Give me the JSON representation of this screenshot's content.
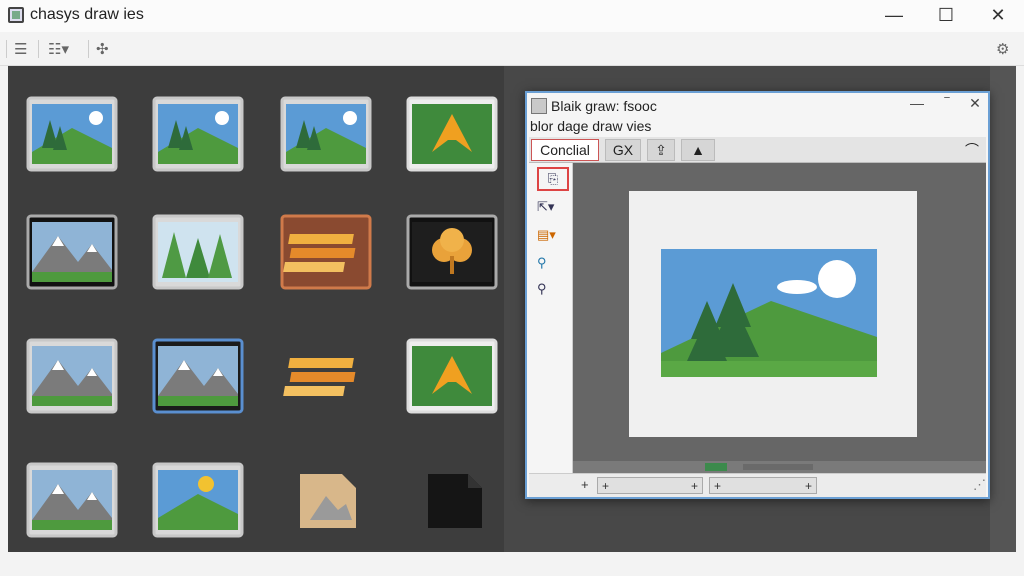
{
  "window": {
    "title": "chasys draw ies",
    "minimize": "—",
    "maximize": "☐",
    "close": "✕"
  },
  "toolbar": {
    "icons": [
      "align-left-icon",
      "list-dropdown-icon",
      "puzzle-icon",
      "gear-icon"
    ],
    "glyph_lines": "☰",
    "glyph_list": "☷▾",
    "glyph_puzzle": "✣",
    "glyph_gear": "⚙"
  },
  "gallery": {
    "rows": 4,
    "cols": 4,
    "items": [
      {
        "type": "landscape",
        "style": "framed"
      },
      {
        "type": "landscape",
        "style": "framed"
      },
      {
        "type": "landscape",
        "style": "folded"
      },
      {
        "type": "vector",
        "style": "green-doc"
      },
      {
        "type": "mountain",
        "style": "dark"
      },
      {
        "type": "forest",
        "style": "framed"
      },
      {
        "type": "stripes",
        "style": "orange"
      },
      {
        "type": "leaf",
        "style": "dark"
      },
      {
        "type": "mountain",
        "style": "framed"
      },
      {
        "type": "mountain",
        "style": "blue-border"
      },
      {
        "type": "stripes",
        "style": "red-outline"
      },
      {
        "type": "vector",
        "style": "green-dark"
      },
      {
        "type": "mountain",
        "style": "framed"
      },
      {
        "type": "sunset",
        "style": "framed"
      },
      {
        "type": "document",
        "style": "tan"
      },
      {
        "type": "document",
        "style": "black"
      }
    ]
  },
  "dialog": {
    "title": "Blaik graw: fsooc",
    "subtitle": "blor dage draw vies",
    "minimize": "—",
    "restore": "‾",
    "close": "✕",
    "tabs": [
      {
        "label": "Conclial",
        "active": true
      },
      {
        "label": "GX",
        "active": false
      },
      {
        "label": "⇪",
        "active": false
      },
      {
        "label": "▲",
        "active": false
      }
    ],
    "tab_right": "⌒",
    "side_tools": [
      "page-icon",
      "resize-icon",
      "color-icon",
      "link-icon",
      "zoom-icon"
    ],
    "side_glyphs": [
      "⎘",
      "⇱▾",
      "▤▾",
      "⚲",
      "⚲"
    ],
    "status": {
      "plus": "+",
      "field_a_left": "+",
      "field_a_right": "+",
      "field_b_left": "+",
      "field_b_right": "+",
      "grip": "⋰"
    }
  },
  "colors": {
    "sky": "#5b9bd5",
    "grass": "#4e9a3e",
    "tree": "#2e6b3a",
    "accent": "#6a9fd4"
  }
}
